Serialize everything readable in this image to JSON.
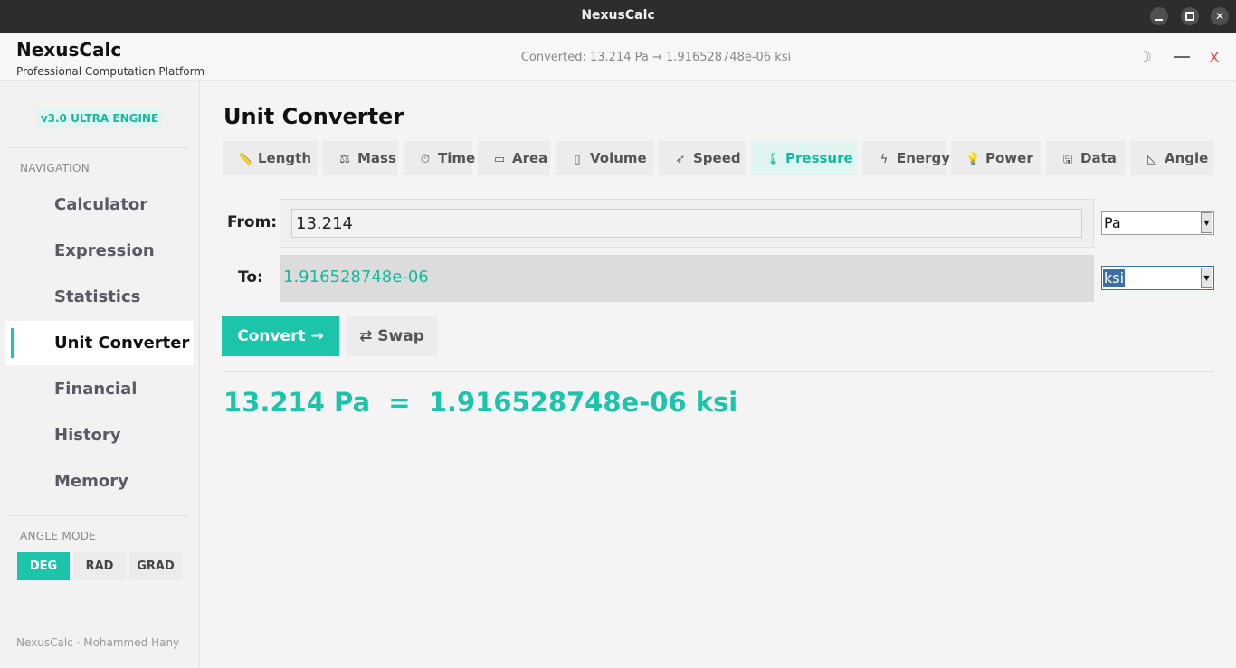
{
  "window": {
    "title": "NexusCalc"
  },
  "header": {
    "app_name": "NexusCalc",
    "tagline": "Professional Computation Platform",
    "status": "Converted: 13.214 Pa → 1.916528748e-06 ksi",
    "theme_icon": "☽",
    "close_glyph": "X"
  },
  "sidebar": {
    "engine_badge": "v3.0  ULTRA ENGINE",
    "nav_heading": "NAVIGATION",
    "nav_items": [
      {
        "label": "Calculator"
      },
      {
        "label": "Expression"
      },
      {
        "label": "Statistics"
      },
      {
        "label": "Unit Converter",
        "active": true
      },
      {
        "label": "Financial"
      },
      {
        "label": "History"
      },
      {
        "label": "Memory"
      }
    ],
    "angle_heading": "ANGLE MODE",
    "angle_modes": [
      {
        "label": "DEG",
        "active": true
      },
      {
        "label": "RAD"
      },
      {
        "label": "GRAD"
      }
    ],
    "footer": "NexusCalc · Mohammed Hany"
  },
  "main": {
    "title": "Unit Converter",
    "tabs": [
      {
        "label": "Length",
        "icon": "ruler-icon",
        "glyph": "📏"
      },
      {
        "label": "Mass",
        "icon": "scale-icon",
        "glyph": "⚖"
      },
      {
        "label": "Time",
        "icon": "clock-icon",
        "glyph": "⏱"
      },
      {
        "label": "Area",
        "icon": "rectangle-icon",
        "glyph": "▭"
      },
      {
        "label": "Volume",
        "icon": "cup-icon",
        "glyph": "▯"
      },
      {
        "label": "Speed",
        "icon": "rocket-icon",
        "glyph": "➶"
      },
      {
        "label": "Pressure",
        "icon": "thermometer-icon",
        "glyph": "🌡",
        "active": true
      },
      {
        "label": "Energy",
        "icon": "bolt-icon",
        "glyph": "ϟ"
      },
      {
        "label": "Power",
        "icon": "bulb-icon",
        "glyph": "💡"
      },
      {
        "label": "Data",
        "icon": "floppy-icon",
        "glyph": "🖫"
      },
      {
        "label": "Angle",
        "icon": "angle-icon",
        "glyph": "◺"
      }
    ],
    "from_label": "From:",
    "from_value": "13.214",
    "from_unit": "Pa",
    "to_label": "To:",
    "to_value": "1.916528748e-06",
    "to_unit": "ksi",
    "convert_label": "Convert →",
    "swap_label": "⇄  Swap",
    "result": "13.214 Pa  =  1.916528748e-06 ksi"
  },
  "colors": {
    "accent": "#1cc4aa",
    "titlebar": "#2d2d2d",
    "close_red": "#e05050"
  }
}
